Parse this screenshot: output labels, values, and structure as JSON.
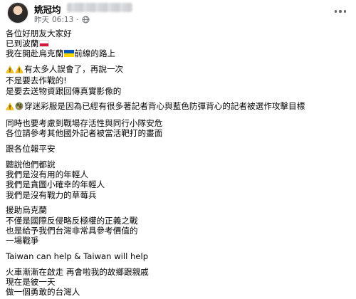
{
  "post": {
    "author_name": "姚冠均",
    "time_prefix": "昨天",
    "time": "06:13",
    "paragraphs": [
      {
        "lines": [
          {
            "text": "各位好朋友大家好"
          },
          {
            "text": "已到波蘭",
            "suffix_icon": "poland-flag-icon"
          },
          {
            "text": "我在開赴烏克蘭",
            "inline_icon": "ukraine-flag-icon",
            "text_after": "前線的路上"
          }
        ]
      },
      {
        "lines": [
          {
            "prefix_icons": [
              "warning-icon",
              "warning-icon"
            ],
            "text": "有太多人誤會了，再說一次"
          },
          {
            "text": "不是要去作戰的!"
          },
          {
            "text": "是要去送物資跟回傳真實影像的"
          }
        ]
      },
      {
        "lines": [
          {
            "prefix_icons": [
              "warning-icon",
              "camouflage-icon"
            ],
            "text": "穿迷彩服是因為已經有很多著記者背心與藍色防彈背心的記者被選作攻擊目標"
          }
        ]
      },
      {
        "lines": [
          {
            "text": "同時也要考慮到戰場存活性與同行小隊安危"
          },
          {
            "text": "各位請參考其他國外記者被當活靶打的畫面"
          }
        ]
      },
      {
        "lines": [
          {
            "text": "跟各位報平安"
          }
        ]
      },
      {
        "lines": [
          {
            "text": "聽說他們都說"
          },
          {
            "text": "我們是沒有用的年輕人"
          },
          {
            "text": "我們是貪圖小確幸的年輕人"
          },
          {
            "text": "我們是沒有戰力的草莓兵"
          }
        ]
      },
      {
        "lines": [
          {
            "text": "援助烏克蘭"
          },
          {
            "text": "不僅是國際反侵略反極權的正義之戰"
          },
          {
            "text": "也是給予我們台灣非常具參考價值的"
          },
          {
            "text": "一場戰爭"
          }
        ]
      },
      {
        "lines": [
          {
            "text": "Taiwan can help & Taiwan will help"
          }
        ]
      },
      {
        "lines": [
          {
            "text": "火車漸漸在啟走 再會啦我的故鄉跟親戚"
          },
          {
            "text": "現在是彼一天"
          },
          {
            "text": "做一個勇敢的台灣人"
          }
        ]
      }
    ]
  }
}
